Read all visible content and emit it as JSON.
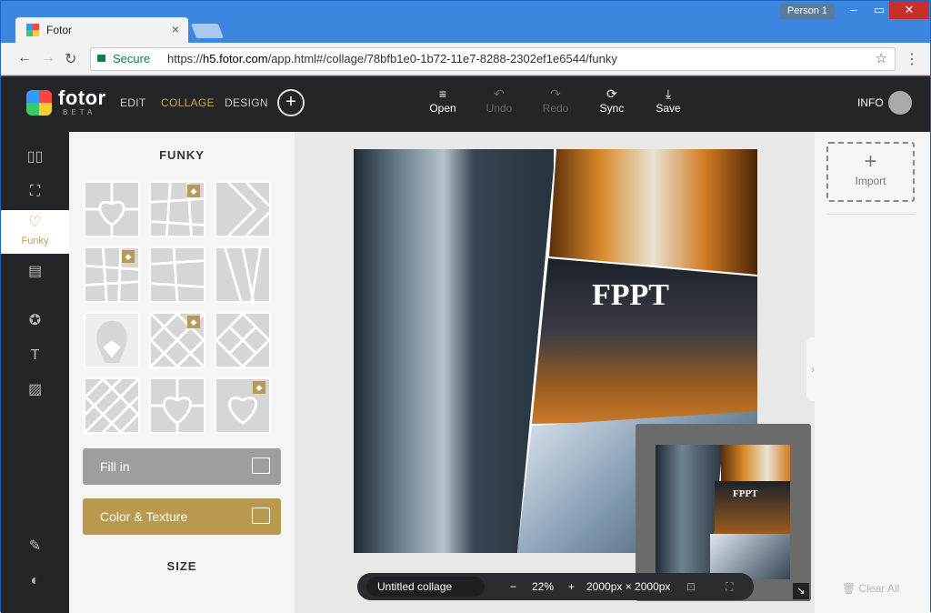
{
  "browser": {
    "tab_title": "Fotor",
    "profile": "Person 1",
    "secure_label": "Secure",
    "url_prefix": "https://",
    "url_host": "h5.fotor.com",
    "url_path": "/app.html#/collage/78bfb1e0-1b72-11e7-8288-2302ef1e6544/funky"
  },
  "header": {
    "logo": "fotor",
    "logo_sub": "BETA",
    "nav": [
      "EDIT",
      "COLLAGE",
      "DESIGN"
    ],
    "tools": [
      {
        "label": "Open",
        "icon": "menu-icon",
        "enabled": true
      },
      {
        "label": "Undo",
        "icon": "undo-icon",
        "enabled": false
      },
      {
        "label": "Redo",
        "icon": "redo-icon",
        "enabled": false
      },
      {
        "label": "Sync",
        "icon": "sync-icon",
        "enabled": true
      },
      {
        "label": "Save",
        "icon": "save-icon",
        "enabled": true
      }
    ],
    "info_label": "INFO"
  },
  "rail": {
    "active_label": "Funky"
  },
  "panel": {
    "title": "FUNKY",
    "fill_label": "Fill in",
    "texture_label": "Color & Texture",
    "size_title": "SIZE"
  },
  "canvas": {
    "collage_text": "FPPT",
    "mini_text": "FPPT",
    "name": "Untitled collage",
    "zoom": "22%",
    "zoom_out": "−",
    "zoom_in": "+",
    "dimensions": "2000px × 2000px"
  },
  "right": {
    "import_label": "Import",
    "clear_label": "Clear All"
  },
  "colors": {
    "accent": "#c9a04a",
    "dark": "#242528"
  }
}
